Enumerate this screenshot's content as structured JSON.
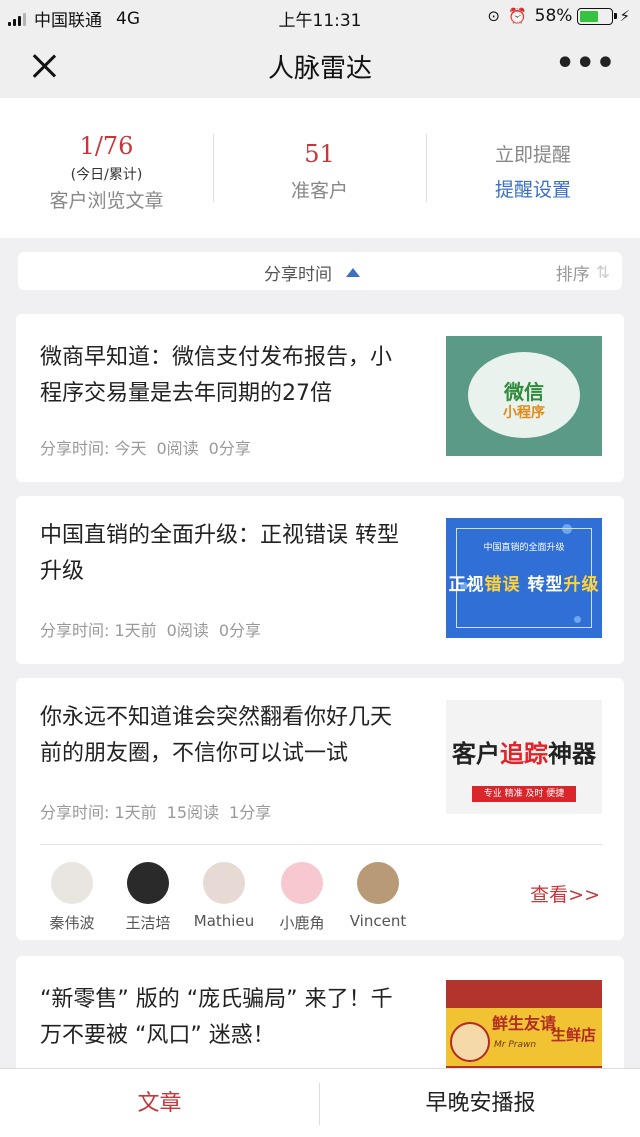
{
  "status_bar": {
    "carrier": "中国联通",
    "network": "4G",
    "time": "上午11:31",
    "battery_percent": "58%",
    "battery_level": 0.58,
    "icons": [
      "signal-icon",
      "rotation-lock-icon",
      "alarm-icon",
      "battery-icon",
      "charging-icon"
    ]
  },
  "nav": {
    "title": "人脉雷达",
    "close_icon": "close-icon",
    "more_icon": "more-icon",
    "more_glyph": "•••"
  },
  "stats": {
    "views": {
      "value": "1/76",
      "sub": "(今日/累计)",
      "label": "客户浏览文章"
    },
    "prospects": {
      "value": "51",
      "label": "准客户"
    },
    "actions": {
      "remind": "立即提醒",
      "settings": "提醒设置"
    }
  },
  "sort_bar": {
    "label": "分享时间",
    "direction_icon": "sort-ascending-icon",
    "sort_label": "排序",
    "sort_icon": "sort-arrows-icon",
    "sort_glyph": "⇅"
  },
  "articles": [
    {
      "title": "微商早知道：微信支付发布报告，小程序交易量是去年同期的27倍",
      "share_time": "分享时间: 今天",
      "reads": "0阅读",
      "shares": "0分享",
      "thumb": {
        "line1": "微信",
        "line2": "小程序"
      }
    },
    {
      "title": "中国直销的全面升级：正视错误 转型升级",
      "share_time": "分享时间: 1天前",
      "reads": "0阅读",
      "shares": "0分享",
      "thumb": {
        "line1": "中国直销的全面升级",
        "line2a": "正视",
        "line2b": "错误",
        "line2c": "转型",
        "line2d": "升级"
      }
    },
    {
      "title": "你永远不知道谁会突然翻看你好几天前的朋友圈，不信你可以试一试",
      "share_time": "分享时间: 1天前",
      "reads": "15阅读",
      "shares": "1分享",
      "thumb": {
        "line1a": "客户",
        "line1b": "追踪",
        "line1c": "神器",
        "line2": "专业  精准  及时  便捷"
      },
      "viewers": [
        {
          "name": "秦伟波",
          "avatar_color": "#e9e6e2"
        },
        {
          "name": "王洁培",
          "avatar_color": "#2a2a2a"
        },
        {
          "name": "Mathieu",
          "avatar_color": "#e7d9d3"
        },
        {
          "name": "小鹿角",
          "avatar_color": "#f7c8cf"
        },
        {
          "name": "Vincent",
          "avatar_color": "#b89a76"
        }
      ],
      "see_more": "查看>>"
    },
    {
      "title": "“新零售” 版的 “庞氏骗局” 来了！千万不要被 “风口” 迷惑！",
      "thumb": {
        "line1": "鲜生友请",
        "line2": "生鲜店",
        "line3": "Mr Prawn"
      }
    }
  ],
  "tabs": [
    {
      "label": "文章",
      "active": true
    },
    {
      "label": "早晚安播报",
      "active": false
    }
  ],
  "colors": {
    "accent_red": "#c7373a",
    "link_blue": "#3b70c4",
    "background": "#f0f0f2"
  }
}
